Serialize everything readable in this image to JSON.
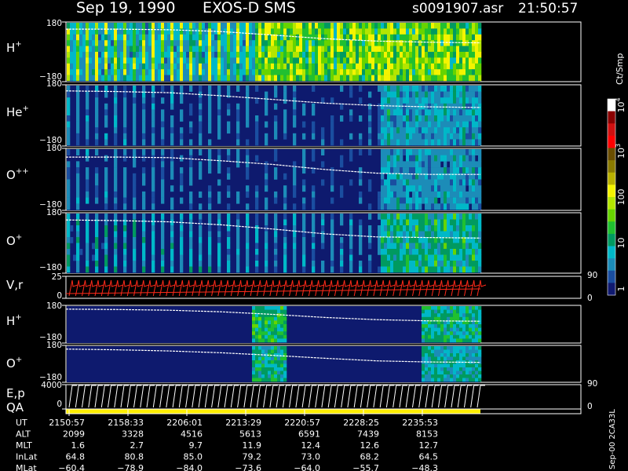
{
  "header": {
    "date": "Sep 19, 1990",
    "instrument": "EXOS-D SMS",
    "file": "s0091907.asr",
    "time": "21:50:57"
  },
  "colors": {
    "background": "#000000",
    "trace": "#ffffff",
    "velocity": "#ff2a1a",
    "qa": "#ffee00"
  },
  "chart_data": {
    "type": "heatmap",
    "panels": [
      {
        "label": "H",
        "superscript": "+",
        "y_top": "180",
        "y_bottom": "−180",
        "y_top_bold": "—180",
        "intensity": "very high"
      },
      {
        "label": "He",
        "superscript": "+",
        "y_top": "180",
        "y_bottom": "−180",
        "intensity": "medium"
      },
      {
        "label": "O",
        "superscript": "++",
        "y_top": "180",
        "y_bottom": "−180",
        "intensity": "medium"
      },
      {
        "label": "O",
        "superscript": "+",
        "y_top": "180",
        "y_bottom": "−180",
        "intensity": "high"
      }
    ],
    "velocity_panel": {
      "label": "V,r",
      "y_top": "25",
      "y_bottom": "0",
      "right_top": "90",
      "right_bottom": "0"
    },
    "lower_panels": [
      {
        "label": "H",
        "superscript": "+",
        "y_top": "180",
        "y_bottom": "−180"
      },
      {
        "label": "O",
        "superscript": "+",
        "y_top": "180",
        "y_bottom": "−180"
      }
    ],
    "energy_panel": {
      "label": "E,p",
      "label2": "QA",
      "y_top": "4000",
      "y_bottom": "0",
      "right_top": "90",
      "right_bottom": "0"
    },
    "colorbar": {
      "unit": "Ct/Smp",
      "ticks": [
        {
          "label": "10",
          "sup": "4",
          "value": 4
        },
        {
          "label": "10",
          "sup": "3",
          "value": 3
        },
        {
          "label": "100",
          "sup": "",
          "value": 2
        },
        {
          "label": "10",
          "sup": "",
          "value": 1
        },
        {
          "label": "1",
          "sup": "",
          "value": 0
        }
      ],
      "colors": [
        "#ffffff",
        "#8b0000",
        "#d01010",
        "#ff0000",
        "#6b4e00",
        "#8a7a00",
        "#b9b000",
        "#f4f400",
        "#b4e600",
        "#67d400",
        "#20c030",
        "#009a60",
        "#00b8c8",
        "#1c8cb8",
        "#1a4ea0",
        "#101a70"
      ]
    },
    "ephemeris": {
      "rows": [
        {
          "label": "UT",
          "values": [
            "2150:57",
            "2158:33",
            "2206:01",
            "2213:29",
            "2220:57",
            "2228:25",
            "2235:53"
          ]
        },
        {
          "label": "ALT",
          "values": [
            "2099",
            "3328",
            "4516",
            "5613",
            "6591",
            "7439",
            "8153"
          ]
        },
        {
          "label": "MLT",
          "values": [
            "1.6",
            "2.7",
            "9.7",
            "11.9",
            "12.4",
            "12.6",
            "12.7"
          ]
        },
        {
          "label": "InLat",
          "values": [
            "64.8",
            "80.8",
            "85.0",
            "79.2",
            "73.0",
            "68.2",
            "64.5"
          ]
        },
        {
          "label": "MLat",
          "values": [
            "−60.4",
            "−78.9",
            "−84.0",
            "−73.6",
            "−64.0",
            "−55.7",
            "−48.3"
          ]
        }
      ]
    },
    "footer_note": "Sep-00 2CA33L",
    "trace_fraction": {
      "panel0": [
        0.12,
        0.12,
        0.13,
        0.16,
        0.22,
        0.28,
        0.32,
        0.34,
        0.35
      ],
      "panel1": [
        0.1,
        0.11,
        0.13,
        0.18,
        0.24,
        0.3,
        0.34,
        0.36,
        0.37
      ],
      "panel2": [
        0.14,
        0.14,
        0.15,
        0.2,
        0.26,
        0.34,
        0.4,
        0.42,
        0.42
      ],
      "panel3": [
        0.12,
        0.13,
        0.15,
        0.2,
        0.27,
        0.35,
        0.4,
        0.41,
        0.42
      ],
      "lower0": [
        0.1,
        0.11,
        0.13,
        0.17,
        0.24,
        0.32,
        0.38,
        0.41,
        0.42
      ],
      "lower1": [
        0.1,
        0.12,
        0.15,
        0.2,
        0.27,
        0.35,
        0.42,
        0.45,
        0.46
      ]
    }
  }
}
